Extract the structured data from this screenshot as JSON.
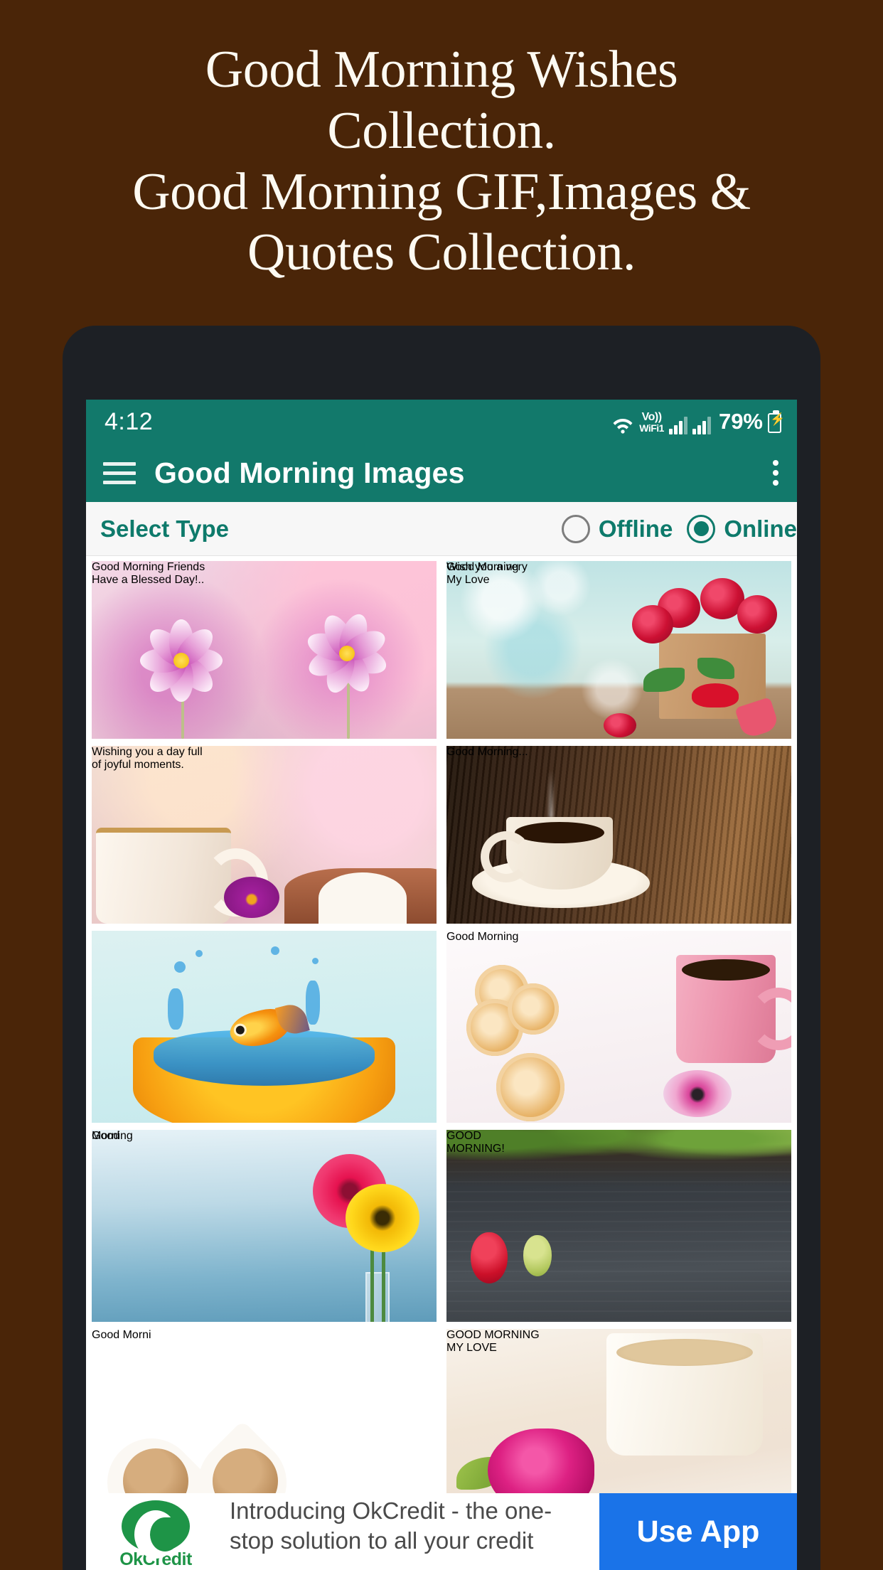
{
  "promo": {
    "lines": [
      "Good Morning Wishes",
      "Collection.",
      "Good Morning GIF,Images &",
      "Quotes Collection."
    ],
    "background_color": "#4a2508",
    "text_color": "#fdfaf2"
  },
  "statusbar": {
    "time": "4:12",
    "vowifi_top": "Vo))",
    "vowifi_bottom": "WiFi1",
    "battery_percent": "79%",
    "icons": [
      "wifi-icon",
      "vowifi-icon",
      "signal-bars-icon",
      "signal-bars-icon",
      "battery-charging-icon"
    ],
    "background_color": "#12796b"
  },
  "appbar": {
    "title": "Good Morning Images",
    "menu_icon": "hamburger-menu-icon",
    "overflow_icon": "more-vertical-icon",
    "background_color": "#12796b",
    "title_color": "#ffffff"
  },
  "select_type": {
    "label": "Select Type",
    "options": [
      {
        "label": "Offline",
        "selected": false
      },
      {
        "label": "Online",
        "selected": true
      }
    ],
    "accent_color": "#0e7a6b"
  },
  "grid": {
    "tiles": [
      {
        "name": "good-morning-friends-flowers",
        "caption": "Good Morning Friends\nHave a Blessed Day!..",
        "description": "Purple and white cosmos flowers on soft pink bokeh background",
        "text_color": "#8f2a84"
      },
      {
        "name": "good-morning-my-love-roses",
        "caption_small": "Wish you a very",
        "caption": "Good Morning\nMy Love",
        "description": "Red roses in a paper bag on teal bokeh hearts background",
        "text_color": "#cb2a22"
      },
      {
        "name": "joyful-moments-cup",
        "caption": "Wishing you a day full\nof joyful moments.",
        "description": "White gold-rimmed cup with purple flower and open book",
        "text_color": "#6a5464"
      },
      {
        "name": "good-morning-coffee-wood",
        "caption": "Good Morning...",
        "description": "Steaming coffee cup and saucer on dark wooden table",
        "text_color": "#fdf7f4"
      },
      {
        "name": "goldfish-orange-splash",
        "caption": "",
        "description": "Goldfish leaping from water inside a halved orange",
        "text_color": "#000000"
      },
      {
        "name": "cookies-pink-mug",
        "caption": "Good Morning",
        "description": "Palmier cookies, pink mug of coffee and pink daisy",
        "text_color": "#6a6a6a"
      },
      {
        "name": "good-morning-gerbera",
        "caption_script": "Good",
        "caption": "Morning",
        "description": "Pink and yellow gerbera daisies in a glass vase on blue gradient",
        "text_color": "#f7e733"
      },
      {
        "name": "good-morning-strawberries-slate",
        "caption": "GOOD\nMORNING!",
        "description": "Strawberries and vines on a dark slate board",
        "text_color": "#dff0c4"
      },
      {
        "name": "good-morning-heart-cups-beans",
        "caption": "Good Morni",
        "description": "Two heart-shaped cups of coffee on roasted coffee beans",
        "text_color": "#ffffff"
      },
      {
        "name": "good-morning-my-love-rose-cup",
        "caption": "GOOD MORNING\nMY LOVE",
        "description": "Pink rose in front of a cup of coffee",
        "text_color": "#e85fb5"
      }
    ]
  },
  "ad": {
    "advertiser": "OkCredit",
    "logo_icon": "okcredit-logo-icon",
    "headline": "Introducing OkCredit - the one-stop solution to all your credit",
    "cta_label": "Use App",
    "cta_color": "#1a73e8"
  }
}
